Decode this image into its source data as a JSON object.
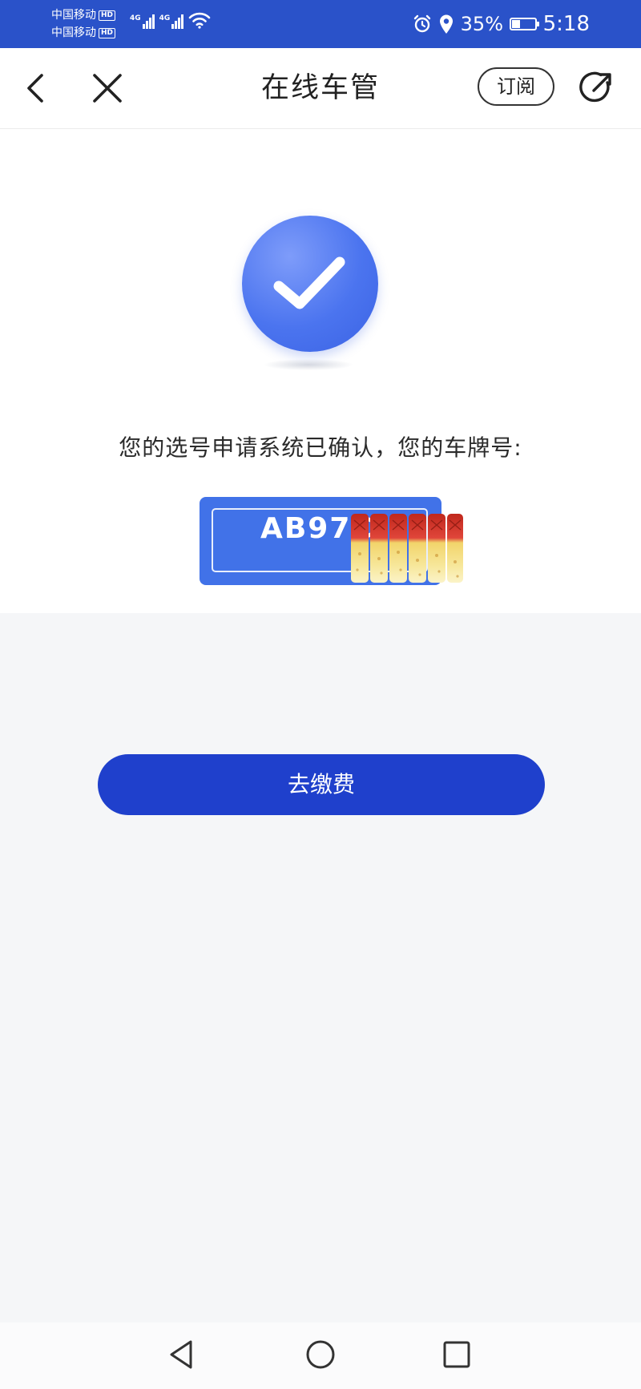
{
  "status_bar": {
    "carrier_1": "中国移动",
    "carrier_2": "中国移动",
    "hd_label": "HD",
    "network_1": "4G",
    "network_2": "4G",
    "battery_percent": "35%",
    "battery_level": 0.35,
    "time": "5:18",
    "icons": [
      "alarm-icon",
      "location-icon",
      "battery-icon",
      "wifi-icon"
    ]
  },
  "nav": {
    "title": "在线车管",
    "subscribe_label": "订阅",
    "icons": [
      "back-arrow-icon",
      "close-icon",
      "share-icon"
    ]
  },
  "result": {
    "icon": "checkmark-icon",
    "message": "您的选号申请系统已确认，您的车牌号:",
    "plate_number": "AB97C"
  },
  "actions": {
    "pay_label": "去缴费"
  },
  "system_nav": {
    "icons": [
      "system-back-icon",
      "system-home-icon",
      "system-recents-icon"
    ]
  },
  "colors": {
    "status_bar": "#2a52c9",
    "accent": "#4172e8",
    "primary_button": "#1f40cc",
    "page_background": "#f5f6f8"
  }
}
